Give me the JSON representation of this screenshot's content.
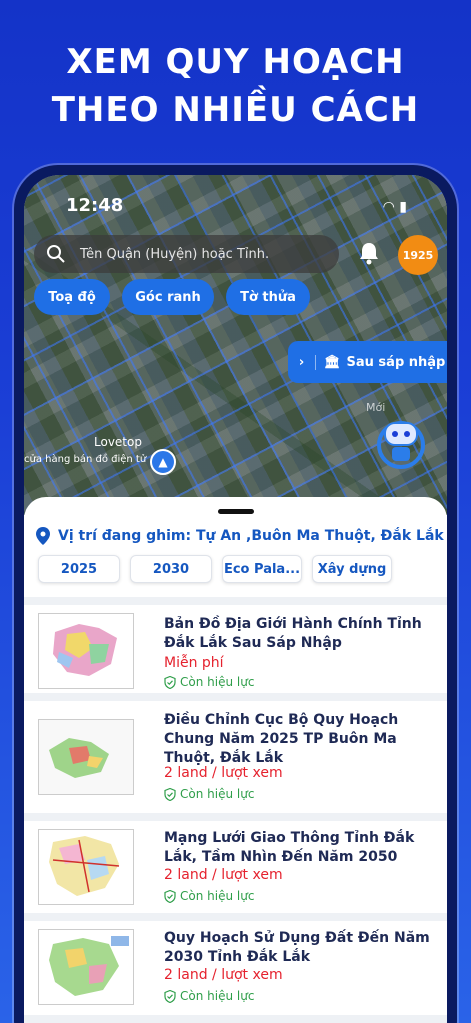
{
  "headline": {
    "line1": "XEM QUY HOẠCH",
    "line2": "THEO NHIỀU CÁCH"
  },
  "status": {
    "time": "12:48"
  },
  "search": {
    "placeholder": "Tên Quận (Huyện) hoặc Tỉnh."
  },
  "points_badge": "1925",
  "filters": {
    "coord": "Toạ độ",
    "corner": "Góc ranh",
    "parcel": "Tờ thửa"
  },
  "after_merge": {
    "label": "Sau sáp nhập"
  },
  "map": {
    "new_label": "Mới",
    "place_name": "Lovetop",
    "place_sub": "cửa hàng bán đồ điện tử"
  },
  "pinned": {
    "label": "Vị trí đang ghim: Tự An ,Buôn Ma Thuột, Đắk Lắk"
  },
  "year_tabs": [
    "2025",
    "2030",
    "Eco Pala...",
    "Xây dựng"
  ],
  "cards": [
    {
      "title": "Bản Đồ Địa Giới Hành Chính Tỉnh Đắk Lắk Sau Sáp Nhập",
      "price": "Miễn phí",
      "status": "Còn hiệu lực"
    },
    {
      "title": "Điều Chỉnh Cục Bộ Quy Hoạch Chung Năm 2025 TP Buôn Ma Thuột, Đắk Lắk",
      "price": "2 land / lượt xem",
      "status": "Còn hiệu lực"
    },
    {
      "title": "Mạng Lưới Giao Thông Tỉnh Đắk Lắk, Tầm Nhìn Đến Năm 2050",
      "price": "2 land / lượt xem",
      "status": "Còn hiệu lực"
    },
    {
      "title": "Quy Hoạch Sử Dụng Đất Đến Năm 2030 Tỉnh Đắk Lắk",
      "price": "2 land / lượt xem",
      "status": "Còn hiệu lực"
    }
  ],
  "colors": {
    "accent": "#1f6fe5",
    "price": "#e5222e",
    "valid": "#2f9e4a",
    "badge": "#f28c13"
  }
}
